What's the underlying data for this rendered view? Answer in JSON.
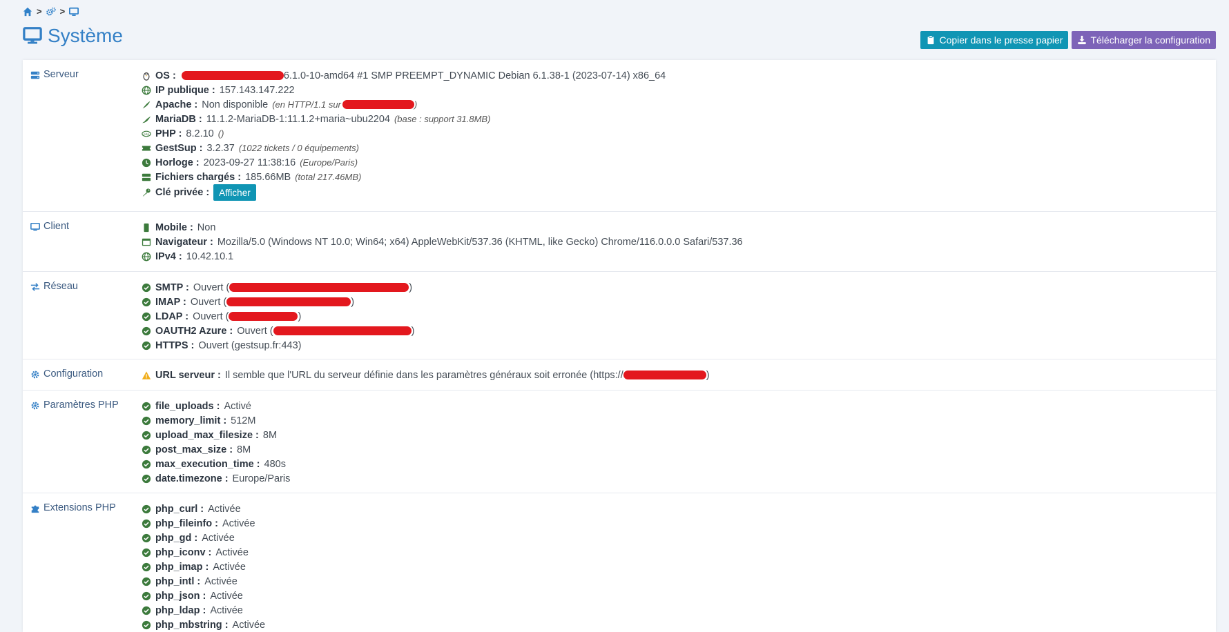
{
  "breadcrumb": {
    "items": [
      "home-icon",
      "settings-icon",
      "monitor-icon"
    ]
  },
  "page": {
    "title": "Système"
  },
  "toolbar": {
    "copy_label": "Copier dans le presse papier",
    "download_label": "Télécharger la configuration"
  },
  "colors": {
    "accent": "#3480c6",
    "info": "#1095b4",
    "purple": "#7d63b8",
    "green": "#3c7a3c",
    "warning": "#f0ad1a",
    "redaction": "#e3181e"
  },
  "server": {
    "label": "Serveur",
    "os": {
      "key": "OS :",
      "value": "6.1.0-10-amd64 #1 SMP PREEMPT_DYNAMIC Debian 6.1.38-1 (2023-07-14) x86_64"
    },
    "ip": {
      "key": "IP publique :",
      "value": "157.143.147.222"
    },
    "apache": {
      "key": "Apache :",
      "value": "Non disponible",
      "note_pre": "(en HTTP/1.1 sur",
      "note_post": ")"
    },
    "mariadb": {
      "key": "MariaDB :",
      "value": "11.1.2-MariaDB-1:11.1.2+maria~ubu2204",
      "note": "(base : support 31.8MB)"
    },
    "php": {
      "key": "PHP :",
      "value": "8.2.10",
      "note": "()"
    },
    "gestsup": {
      "key": "GestSup :",
      "value": "3.2.37",
      "note": "(1022 tickets / 0 équipements)"
    },
    "clock": {
      "key": "Horloge :",
      "value": "2023-09-27 11:38:16",
      "note": "(Europe/Paris)"
    },
    "files": {
      "key": "Fichiers chargés :",
      "value": "185.66MB",
      "note": "(total 217.46MB)"
    },
    "key": {
      "key": "Clé privée :",
      "button": "Afficher"
    }
  },
  "client": {
    "label": "Client",
    "mobile": {
      "key": "Mobile :",
      "value": "Non"
    },
    "browser": {
      "key": "Navigateur :",
      "value": "Mozilla/5.0 (Windows NT 10.0; Win64; x64) AppleWebKit/537.36 (KHTML, like Gecko) Chrome/116.0.0.0 Safari/537.36"
    },
    "ipv4": {
      "key": "IPv4 :",
      "value": "10.42.10.1"
    }
  },
  "network": {
    "label": "Réseau",
    "items": [
      {
        "key": "SMTP :",
        "value": "Ouvert (",
        "close": ")"
      },
      {
        "key": "IMAP :",
        "value": "Ouvert (",
        "close": ")"
      },
      {
        "key": "LDAP :",
        "value": "Ouvert (",
        "close": ")"
      },
      {
        "key": "OAUTH2 Azure :",
        "value": "Ouvert (",
        "close": ")"
      },
      {
        "key": "HTTPS :",
        "value": "Ouvert (gestsup.fr:443)",
        "close": ""
      }
    ]
  },
  "configuration": {
    "label": "Configuration",
    "key": "URL serveur :",
    "value": "Il semble que l'URL du serveur définie dans les paramètres généraux soit erronée (https://",
    "close": ")"
  },
  "php_params": {
    "label": "Paramètres PHP",
    "items": [
      {
        "key": "file_uploads :",
        "value": "Activé"
      },
      {
        "key": "memory_limit :",
        "value": "512M"
      },
      {
        "key": "upload_max_filesize :",
        "value": "8M"
      },
      {
        "key": "post_max_size :",
        "value": "8M"
      },
      {
        "key": "max_execution_time :",
        "value": "480s"
      },
      {
        "key": "date.timezone :",
        "value": "Europe/Paris"
      }
    ]
  },
  "php_ext": {
    "label": "Extensions PHP",
    "items": [
      {
        "key": "php_curl :",
        "value": "Activée"
      },
      {
        "key": "php_fileinfo :",
        "value": "Activée"
      },
      {
        "key": "php_gd :",
        "value": "Activée"
      },
      {
        "key": "php_iconv :",
        "value": "Activée"
      },
      {
        "key": "php_imap :",
        "value": "Activée"
      },
      {
        "key": "php_intl :",
        "value": "Activée"
      },
      {
        "key": "php_json :",
        "value": "Activée"
      },
      {
        "key": "php_ldap :",
        "value": "Activée"
      },
      {
        "key": "php_mbstring :",
        "value": "Activée"
      }
    ]
  }
}
